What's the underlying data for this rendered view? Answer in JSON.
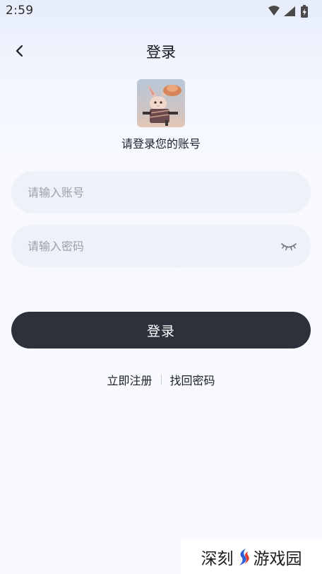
{
  "status_bar": {
    "time": "2:59",
    "icons": [
      "wifi-icon",
      "signal-icon",
      "battery-icon"
    ]
  },
  "header": {
    "back_icon": "chevron-left-icon",
    "title": "登录"
  },
  "profile": {
    "avatar": "avatar-image",
    "subtitle": "请登录您的账号"
  },
  "form": {
    "account": {
      "placeholder": "请输入账号",
      "value": ""
    },
    "password": {
      "placeholder": "请输入密码",
      "value": "",
      "toggle_icon": "eye-closed-icon"
    },
    "submit_label": "登录"
  },
  "links": {
    "register": "立即注册",
    "forgot_password": "找回密码"
  },
  "watermark": {
    "text_left": "深刻",
    "text_right": "游戏园"
  },
  "colors": {
    "primary_button": "#2d313c",
    "field_background": "#eef1f7",
    "placeholder": "#9aa0ac",
    "page_background": "#f8faff",
    "watermark_blue": "#2f5fd8",
    "watermark_red": "#e23a2c"
  }
}
